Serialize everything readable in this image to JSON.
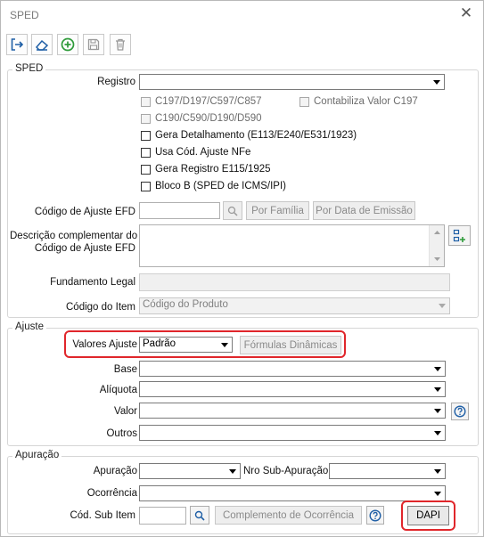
{
  "window": {
    "title": "SPED"
  },
  "groups": {
    "sped": "SPED",
    "ajuste": "Ajuste",
    "apuracao": "Apuração"
  },
  "sped": {
    "registro_label": "Registro",
    "registro_value": "",
    "checkboxes": [
      {
        "label": "C197/D197/C597/C857",
        "checked": false,
        "disabled": true
      },
      {
        "label": "Contabiliza Valor C197",
        "checked": false,
        "disabled": true
      },
      {
        "label": "C190/C590/D190/D590",
        "checked": false,
        "disabled": true
      },
      {
        "label": "Gera Detalhamento (E113/E240/E531/1923)",
        "checked": false,
        "disabled": false
      },
      {
        "label": "Usa Cód. Ajuste NFe",
        "checked": false,
        "disabled": false
      },
      {
        "label": "Gera Registro E115/1925",
        "checked": false,
        "disabled": false
      },
      {
        "label": "Bloco B (SPED de ICMS/IPI)",
        "checked": false,
        "disabled": false
      }
    ],
    "codigo_ajuste_label": "Código de Ajuste EFD",
    "codigo_ajuste_value": "",
    "por_familia": "Por Família",
    "por_data_emissao": "Por Data de Emissão",
    "descricao_label_1": "Descrição complementar do",
    "descricao_label_2": "Código de Ajuste EFD",
    "descricao_value": "",
    "fundamento_label": "Fundamento Legal",
    "fundamento_value": "",
    "codigo_item_label": "Código do Item",
    "codigo_item_value": "Código do Produto"
  },
  "ajuste": {
    "valores_ajuste_label": "Valores Ajuste",
    "valores_ajuste_value": "Padrão",
    "formulas_dinamicas": "Fórmulas Dinâmicas",
    "base_label": "Base",
    "base_value": "",
    "aliquota_label": "Alíquota",
    "aliquota_value": "",
    "valor_label": "Valor",
    "valor_value": "",
    "outros_label": "Outros",
    "outros_value": ""
  },
  "apuracao": {
    "apuracao_label": "Apuração",
    "apuracao_value": "",
    "nro_sub_label": "Nro Sub-Apuração",
    "nro_sub_value": "",
    "ocorrencia_label": "Ocorrência",
    "ocorrencia_value": "",
    "cod_sub_item_label": "Cód. Sub Item",
    "cod_sub_item_value": "",
    "complemento_ocorrencia": "Complemento de Ocorrência",
    "dapi": "DAPI"
  },
  "colors": {
    "highlight": "#e0262b",
    "add_icon": "#2e9b3a",
    "link_icon": "#1f5fa6"
  }
}
